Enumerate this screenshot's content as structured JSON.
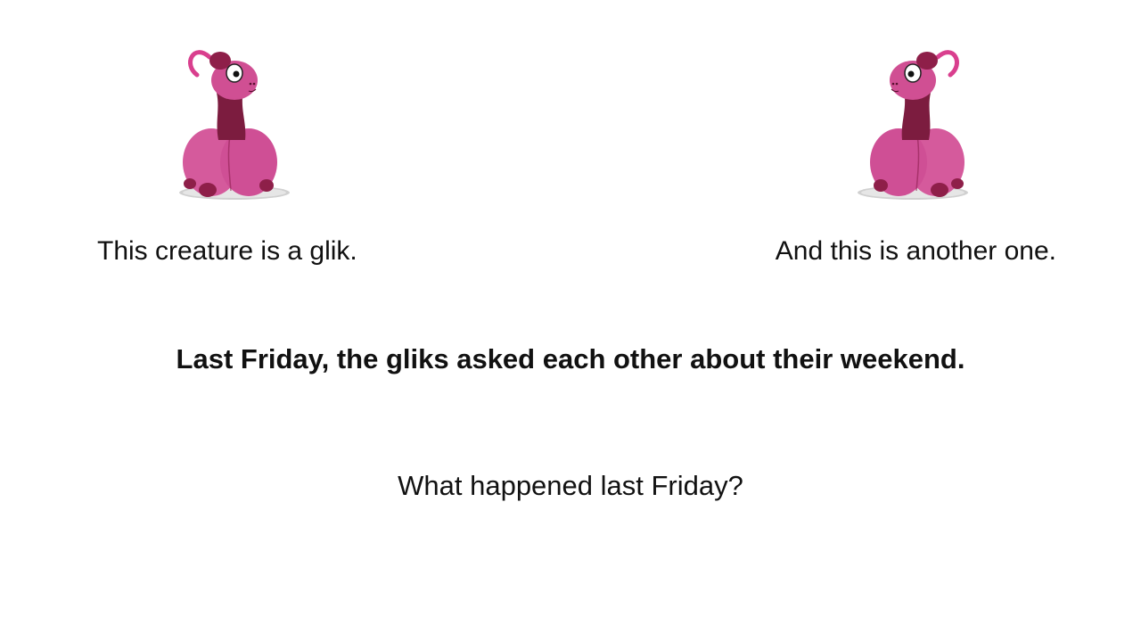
{
  "slide": {
    "caption_left": "This creature is a glik.",
    "caption_right": "And this is another one.",
    "headline": "Last Friday, the gliks asked each other about their weekend.",
    "question": "What happened last Friday?"
  },
  "creatures": [
    {
      "icon": "glik-creature-illustration",
      "facing": "right"
    },
    {
      "icon": "glik-creature-illustration",
      "facing": "left"
    }
  ],
  "colors": {
    "body_pink": "#d4559b",
    "body_dark": "#8e1f49",
    "neck": "#7a1a3e",
    "shadow": "#c9c9c9"
  }
}
